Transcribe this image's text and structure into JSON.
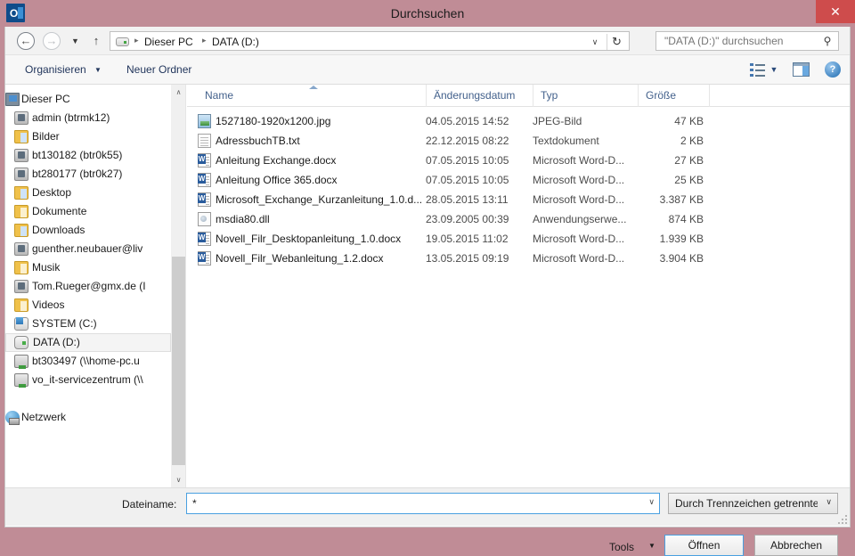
{
  "window": {
    "title": "Durchsuchen",
    "app_icon": "outlook-icon",
    "close_label": "✕",
    "titlebar_color": "#c08c96",
    "close_color": "#ce4c4c",
    "accent_color": "#4aa0e0"
  },
  "nav": {
    "back_glyph": "←",
    "forward_glyph": "→",
    "recent_glyph": "▼",
    "up_glyph": "↑",
    "refresh_glyph": "↻",
    "dropdown_glyph": "∨",
    "breadcrumb": {
      "sep": "▸",
      "items": [
        "Dieser PC",
        "DATA (D:)"
      ]
    },
    "search": {
      "value": "",
      "placeholder": "\"DATA (D:)\" durchsuchen",
      "icon": "search-icon",
      "icon_glyph": "⚲"
    }
  },
  "toolbar": {
    "organize_label": "Organisieren",
    "organize_caret": "▼",
    "newfolder_label": "Neuer Ordner",
    "view_caret": "▼",
    "help_glyph": "?",
    "icons": [
      "list-view-icon",
      "preview-pane-icon",
      "help-icon"
    ]
  },
  "sidebar": {
    "scroll_up_glyph": "∧",
    "scroll_down_glyph": "∨",
    "items": [
      {
        "label": "Dieser PC",
        "icon": "computer-icon",
        "level": 0,
        "selected": false
      },
      {
        "label": "admin (btrmk12)",
        "icon": "user-folder-icon",
        "level": 1,
        "selected": false
      },
      {
        "label": "Bilder",
        "icon": "pictures-folder-icon",
        "level": 1,
        "selected": false
      },
      {
        "label": "bt130182 (btr0k55)",
        "icon": "user-folder-icon",
        "level": 1,
        "selected": false
      },
      {
        "label": "bt280177 (btr0k27)",
        "icon": "user-folder-icon",
        "level": 1,
        "selected": false
      },
      {
        "label": "Desktop",
        "icon": "desktop-folder-icon",
        "level": 1,
        "selected": false
      },
      {
        "label": "Dokumente",
        "icon": "documents-folder-icon",
        "level": 1,
        "selected": false
      },
      {
        "label": "Downloads",
        "icon": "downloads-folder-icon",
        "level": 1,
        "selected": false
      },
      {
        "label": "guenther.neubauer@liv",
        "icon": "user-folder-icon",
        "level": 1,
        "selected": false
      },
      {
        "label": "Musik",
        "icon": "music-folder-icon",
        "level": 1,
        "selected": false
      },
      {
        "label": "Tom.Rueger@gmx.de (I",
        "icon": "user-folder-icon",
        "level": 1,
        "selected": false
      },
      {
        "label": "Videos",
        "icon": "videos-folder-icon",
        "level": 1,
        "selected": false
      },
      {
        "label": "SYSTEM (C:)",
        "icon": "system-drive-icon",
        "level": 1,
        "selected": false
      },
      {
        "label": "DATA (D:)",
        "icon": "drive-icon",
        "level": 1,
        "selected": true
      },
      {
        "label": "bt303497 (\\\\home-pc.u",
        "icon": "network-drive-icon",
        "level": 1,
        "selected": false
      },
      {
        "label": "vo_it-servicezentrum (\\\\",
        "icon": "network-drive-icon",
        "level": 1,
        "selected": false
      },
      {
        "label": "Netzwerk",
        "icon": "network-icon",
        "level": 0,
        "selected": false
      }
    ]
  },
  "filelist": {
    "columns": [
      {
        "label": "Name",
        "key": "name",
        "sorted": "asc"
      },
      {
        "label": "Änderungsdatum",
        "key": "date"
      },
      {
        "label": "Typ",
        "key": "type"
      },
      {
        "label": "Größe",
        "key": "size"
      }
    ],
    "rows": [
      {
        "name": "1527180-1920x1200.jpg",
        "date": "04.05.2015 14:52",
        "type": "JPEG-Bild",
        "size": "47 KB",
        "icon": "image-file-icon"
      },
      {
        "name": "AdressbuchTB.txt",
        "date": "22.12.2015 08:22",
        "type": "Textdokument",
        "size": "2 KB",
        "icon": "text-file-icon"
      },
      {
        "name": "Anleitung Exchange.docx",
        "date": "07.05.2015 10:05",
        "type": "Microsoft Word-D...",
        "size": "27 KB",
        "icon": "word-file-icon"
      },
      {
        "name": "Anleitung Office 365.docx",
        "date": "07.05.2015 10:05",
        "type": "Microsoft Word-D...",
        "size": "25 KB",
        "icon": "word-file-icon"
      },
      {
        "name": "Microsoft_Exchange_Kurzanleitung_1.0.d...",
        "date": "28.05.2015 13:11",
        "type": "Microsoft Word-D...",
        "size": "3.387 KB",
        "icon": "word-file-icon"
      },
      {
        "name": "msdia80.dll",
        "date": "23.09.2005 00:39",
        "type": "Anwendungserwe...",
        "size": "874 KB",
        "icon": "dll-file-icon"
      },
      {
        "name": "Novell_Filr_Desktopanleitung_1.0.docx",
        "date": "19.05.2015 11:02",
        "type": "Microsoft Word-D...",
        "size": "1.939 KB",
        "icon": "word-file-icon"
      },
      {
        "name": "Novell_Filr_Webanleitung_1.2.docx",
        "date": "13.05.2015 09:19",
        "type": "Microsoft Word-D...",
        "size": "3.904 KB",
        "icon": "word-file-icon"
      }
    ]
  },
  "bottom": {
    "filename_label": "Dateiname:",
    "filename_value": "*",
    "filename_caret": "∨",
    "filetype_value": "Durch Trennzeichen getrennte '",
    "filetype_caret": "∨",
    "tools_label": "Tools",
    "tools_caret": "▼",
    "open_label": "Öffnen",
    "cancel_label": "Abbrechen"
  }
}
